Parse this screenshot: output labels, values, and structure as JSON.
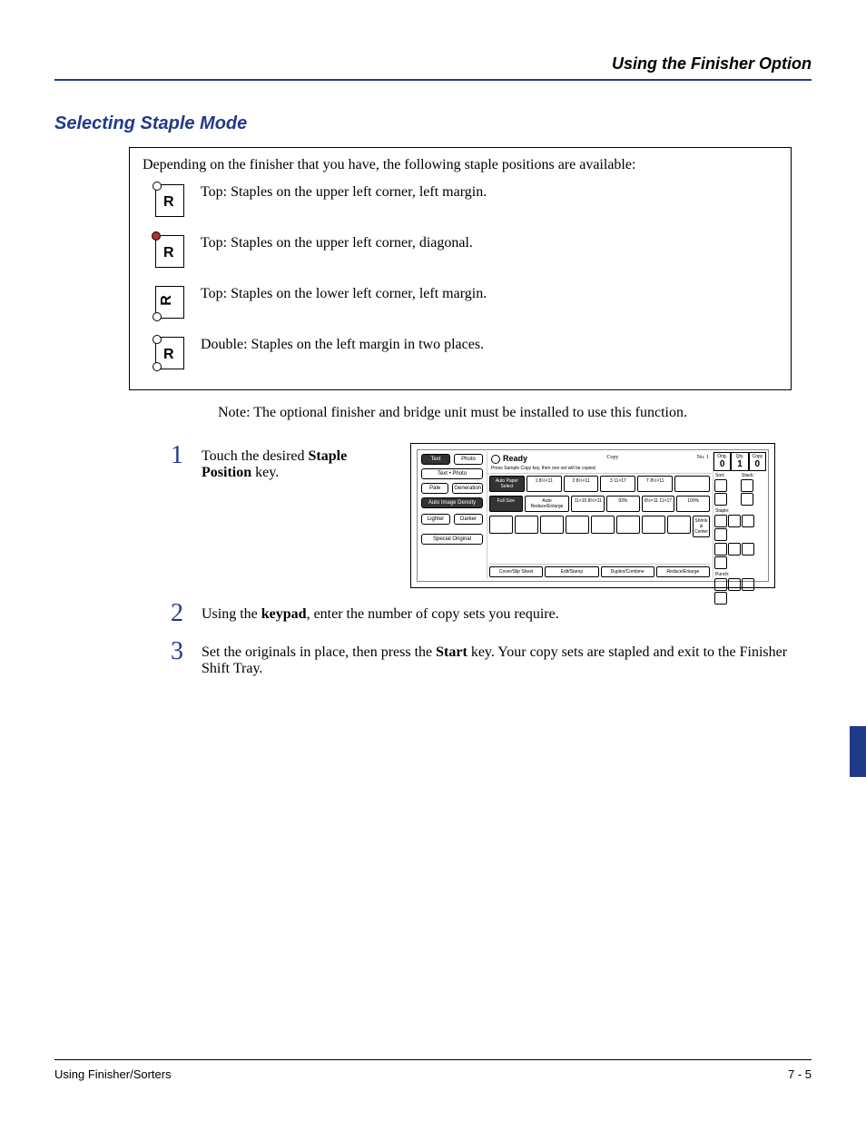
{
  "header": {
    "right": "Using the Finisher Option"
  },
  "section_title": "Selecting Staple Mode",
  "box": {
    "intro": "Depending on the finisher that you have, the following staple positions are available:",
    "items": [
      {
        "desc": "Top: Staples on the upper left corner, left margin."
      },
      {
        "desc": "Top: Staples on the upper left corner, diagonal."
      },
      {
        "desc": "Top: Staples on the lower left corner, left margin."
      },
      {
        "desc": "Double: Staples on the left margin in two places."
      }
    ]
  },
  "note": "Note:  The optional finisher and bridge unit must be installed to use this function.",
  "steps": [
    {
      "num": "1",
      "pre": "Touch the desired ",
      "bold": "Staple Position",
      "post": " key."
    },
    {
      "num": "2",
      "pre": "Using the ",
      "bold": "keypad",
      "post": ", enter the number of copy sets you require."
    },
    {
      "num": "3",
      "pre": "Set the originals in place, then press the ",
      "bold": "Start",
      "post": " key. Your copy sets are stapled and exit to the Finisher Shift Tray."
    }
  ],
  "panel": {
    "ready": "Ready",
    "sub": "Press Sample Copy key, then one set will be copied.",
    "top_center": "Copy",
    "top_right": "No. 1",
    "left": {
      "text": "Text",
      "photo": "Photo",
      "textphoto": "Text • Photo",
      "pale": "Pale",
      "generation": "Generation",
      "autodensity": "Auto Image Density",
      "lighter": "Lighter",
      "darker": "Darker",
      "special": "Special Original"
    },
    "trays": {
      "autopaper": "Auto Paper Select",
      "t1": "1  8½×11",
      "t2": "2  8½×11",
      "t3": "3  11×17",
      "t4": "T  8½×11",
      "t5": ""
    },
    "scale": {
      "fullsize": "Full Size",
      "autore": "Auto Reduce/Enlarge",
      "s1": "11×15 8½×11",
      "s1p": "93%",
      "s2": "8½×11 11×17",
      "s2p": "100%",
      "shrink": "Shrink & Center"
    },
    "bottom": {
      "cover": "Cover/Slip Sheet",
      "edit": "Edit/Stamp",
      "duplex": "Duplex/Combine",
      "reduce": "Reduce/Enlarge"
    },
    "right": {
      "orig": "Orig.",
      "orig_n": "0",
      "qty": "Qty.",
      "qty_n": "1",
      "copy": "Copy",
      "copy_n": "0",
      "sort": "Sort:",
      "stack": "Stack:",
      "staple": "Staple:",
      "punch": "Punch:"
    }
  },
  "footer": {
    "left": "Using Finisher/Sorters",
    "right": "7 - 5"
  }
}
